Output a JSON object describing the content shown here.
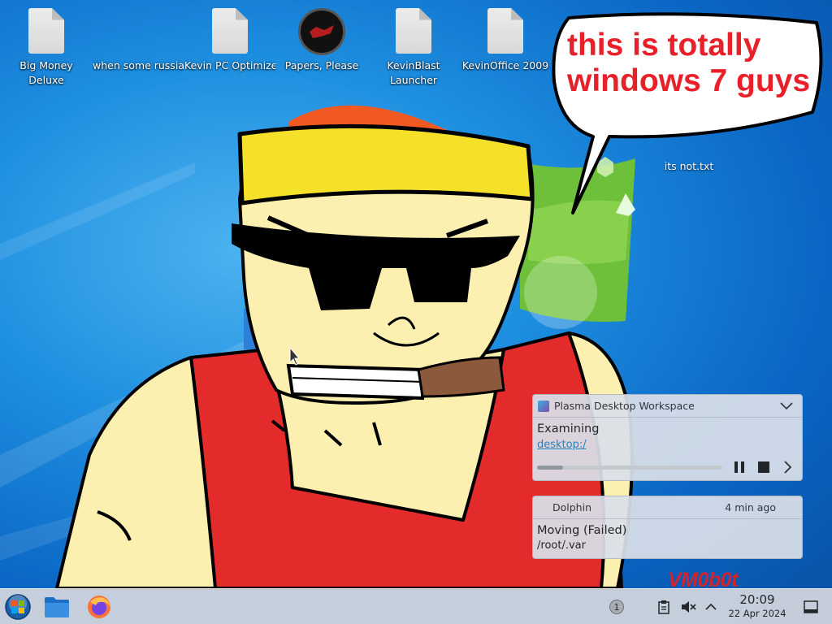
{
  "desktop": {
    "icons": [
      {
        "label": "Big Money Deluxe"
      },
      {
        "label": "when some russian runs a..."
      },
      {
        "label": "Kevin PC Optimizer Ho..."
      },
      {
        "label": "Papers, Please"
      },
      {
        "label": "KevinBlast Launcher"
      },
      {
        "label": "KevinOffice 2009"
      }
    ],
    "txt_file": {
      "label": "its not.txt"
    },
    "speech_bubble": {
      "text": "this is totally windows 7 guys"
    },
    "signature": "VM0b0t"
  },
  "notifications": [
    {
      "app": "Plasma Desktop Workspace",
      "title": "Examining",
      "link": "desktop:/",
      "progress": 0.14
    },
    {
      "app": "Dolphin",
      "time": "4 min ago",
      "title": "Moving (Failed)",
      "text": "/root/.var"
    }
  ],
  "taskbar": {
    "launchers": [
      {
        "icon": "start-menu-orb-icon"
      },
      {
        "icon": "folder-icon"
      },
      {
        "icon": "firefox-icon"
      }
    ],
    "notification_count": "1",
    "tray_icons": [
      "clipboard-icon",
      "volume-muted-icon",
      "chevron-up-icon"
    ],
    "clock": {
      "time": "20:09",
      "date": "22 Apr 2024"
    },
    "show_desktop_icon": "show-desktop-icon"
  },
  "colors": {
    "wallpaper_blue": "#1e8fe0",
    "speech_red": "#e8202a",
    "link_blue": "#2980b9",
    "tank_red": "#e42b2b",
    "skin": "#fbf0b0",
    "headband": "#f5e02a"
  }
}
